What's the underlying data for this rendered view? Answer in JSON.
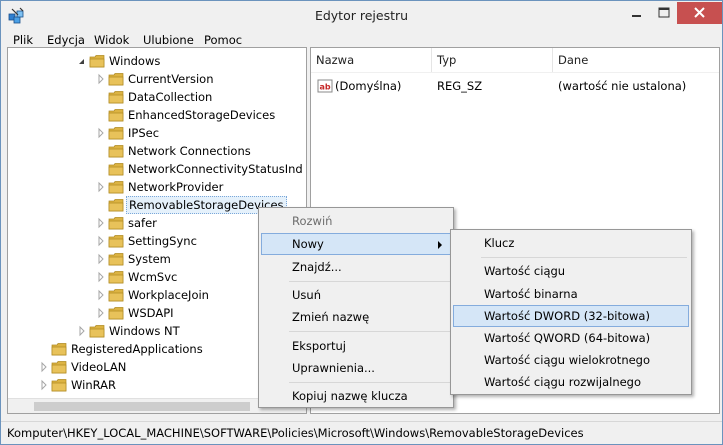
{
  "window": {
    "title": "Edytor rejestru"
  },
  "menu": [
    "Plik",
    "Edycja",
    "Widok",
    "Ulubione",
    "Pomoc"
  ],
  "tree": [
    {
      "label": "Windows",
      "expanded": true
    },
    {
      "label": "CurrentVersion"
    },
    {
      "label": "DataCollection"
    },
    {
      "label": "EnhancedStorageDevices"
    },
    {
      "label": "IPSec"
    },
    {
      "label": "Network Connections"
    },
    {
      "label": "NetworkConnectivityStatusInd"
    },
    {
      "label": "NetworkProvider"
    },
    {
      "label": "RemovableStorageDevices",
      "selected": true
    },
    {
      "label": "safer"
    },
    {
      "label": "SettingSync"
    },
    {
      "label": "System"
    },
    {
      "label": "WcmSvc"
    },
    {
      "label": "WorkplaceJoin"
    },
    {
      "label": "WSDAPI"
    },
    {
      "label": "Windows NT"
    },
    {
      "label": "RegisteredApplications"
    },
    {
      "label": "VideoLAN"
    },
    {
      "label": "WinRAR"
    }
  ],
  "list": {
    "columns": [
      "Nazwa",
      "Typ",
      "Dane"
    ],
    "rows": [
      {
        "name": "(Domyślna)",
        "type": "REG_SZ",
        "data": "(wartość nie ustalona)"
      }
    ]
  },
  "context_menu": {
    "items": [
      "Rozwiń",
      "Nowy",
      "Znajdź...",
      "Usuń",
      "Zmień nazwę",
      "Eksportuj",
      "Uprawnienia...",
      "Kopiuj nazwę klucza"
    ]
  },
  "submenu": {
    "items": [
      "Klucz",
      "Wartość ciągu",
      "Wartość binarna",
      "Wartość DWORD (32-bitowa)",
      "Wartość QWORD (64-bitowa)",
      "Wartość ciągu wielokrotnego",
      "Wartość ciągu rozwijalnego"
    ]
  },
  "status": {
    "path": "Komputer\\HKEY_LOCAL_MACHINE\\SOFTWARE\\Policies\\Microsoft\\Windows\\RemovableStorageDevices"
  },
  "colors": {
    "highlight": "#d5e6f7",
    "close_button": "#c75050",
    "folder": "#e8c25a"
  }
}
